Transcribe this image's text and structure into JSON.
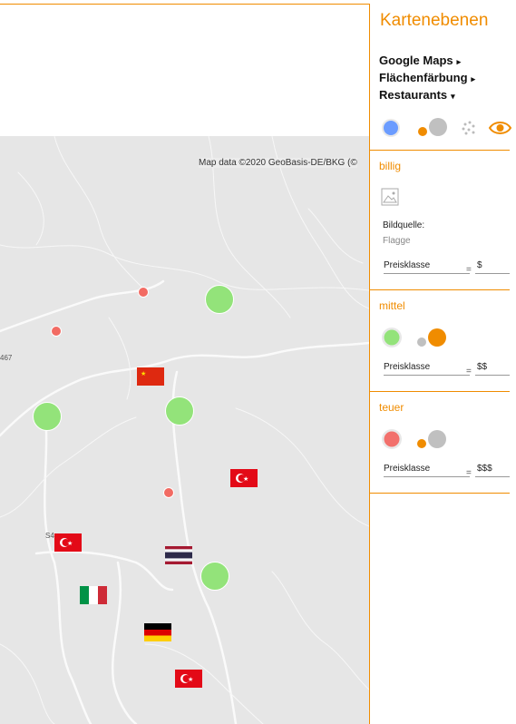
{
  "panel": {
    "title": "Kartenebenen",
    "layers": [
      {
        "label": "Google Maps",
        "arrow": "▸"
      },
      {
        "label": "Flächenfärbung",
        "arrow": "▸"
      },
      {
        "label": "Restaurants",
        "arrow": "▾"
      }
    ],
    "sections": [
      {
        "title": "billig",
        "source_label": "Bildquelle:",
        "source_value": "Flagge",
        "field_label": "Preisklasse",
        "field_eq": "=",
        "field_value": "$",
        "color": "#f26b63"
      },
      {
        "title": "mittel",
        "field_label": "Preisklasse",
        "field_eq": "=",
        "field_value": "$$",
        "color": "#93e37a"
      },
      {
        "title": "teuer",
        "field_label": "Preisklasse",
        "field_eq": "=",
        "field_value": "$$$",
        "color": "#f2706c"
      }
    ],
    "accent": "#f08c00"
  },
  "map": {
    "attribution": "Map data ©2020 GeoBasis-DE/BKG (©",
    "road_labels": [
      "467",
      "S4"
    ]
  }
}
